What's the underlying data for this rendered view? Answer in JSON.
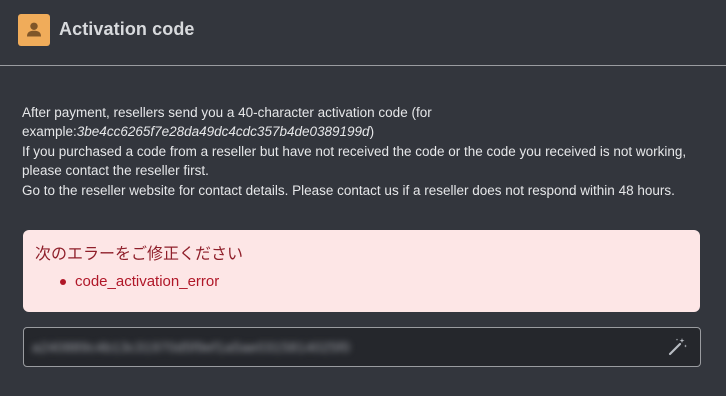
{
  "header": {
    "title": "Activation code",
    "icon": "user-icon",
    "icon_color": "#f0ac5a"
  },
  "info": {
    "line1_prefix": "After payment, resellers send you a 40-character activation code (for",
    "line2_prefix": "example:",
    "example_code": "3be4cc6265f7e28da49dc4cdc357b4de0389199d",
    "line2_suffix": ")",
    "line3": "If you purchased a code from a reseller but have not received the code or the code you received is not working, please contact the reseller first.",
    "line4": "Go to the reseller website for contact details. Please contact us if a reseller does not respond within 48 hours."
  },
  "alert": {
    "title": "次のエラーをご修正ください",
    "errors": [
      "code_activation_error"
    ],
    "background": "#fde6e6",
    "text_color": "#b01728"
  },
  "code_input": {
    "value": "a240889c4b13c31970d5f9ef1a5ae0315814025f0",
    "icon": "magic-wand-icon"
  }
}
